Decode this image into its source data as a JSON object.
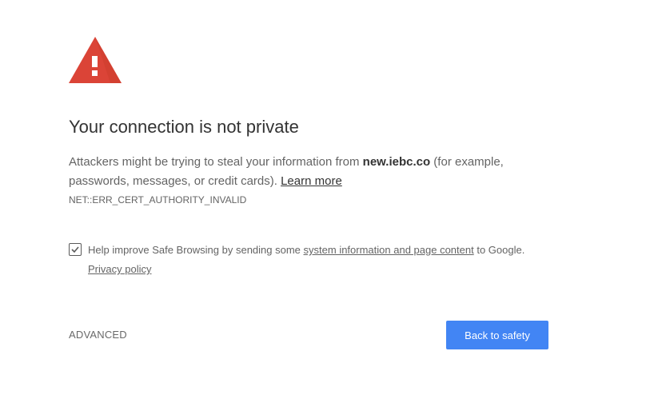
{
  "icon": {
    "name": "warning-triangle-icon",
    "color": "#db4437"
  },
  "heading": {
    "title": "Your connection is not private"
  },
  "explanation": {
    "text_before": "Attackers might be trying to steal your information from ",
    "domain": "new.iebc.co",
    "text_after": " (for example, passwords, messages, or credit cards). ",
    "learn_more": "Learn more"
  },
  "error_code": "NET::ERR_CERT_AUTHORITY_INVALID",
  "safe_browsing": {
    "checked": true,
    "text_before": "Help improve Safe Browsing by sending some ",
    "link": "system information and page content",
    "text_after": " to Google.",
    "privacy_policy": "Privacy policy"
  },
  "buttons": {
    "advanced": "ADVANCED",
    "back_to_safety": "Back to safety"
  },
  "colors": {
    "primary_button": "#4285f4",
    "title_text": "#333333",
    "body_text": "#646464",
    "warning_red": "#db4437"
  }
}
